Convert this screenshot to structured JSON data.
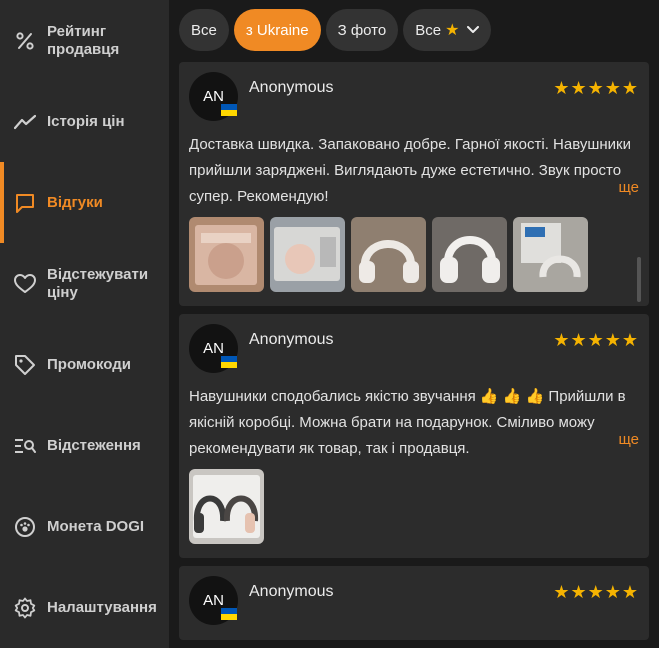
{
  "sidebar": {
    "items": [
      {
        "label": "Рейтинг продавця",
        "icon": "percent-icon"
      },
      {
        "label": "Історія цін",
        "icon": "trend-line-icon"
      },
      {
        "label": "Відгуки",
        "icon": "chat-bubble-icon",
        "active": true
      },
      {
        "label": "Відстежувати ціну",
        "icon": "heart-icon"
      },
      {
        "label": "Промокоди",
        "icon": "tag-icon"
      },
      {
        "label": "Відстеження",
        "icon": "list-search-icon"
      },
      {
        "label": "Монета DOGI",
        "icon": "coin-paw-icon"
      },
      {
        "label": "Налаштування",
        "icon": "gear-icon"
      }
    ]
  },
  "filters": {
    "all": "Все",
    "ukraine": "з Ukraine",
    "with_photo": "З фото",
    "rating": "Все"
  },
  "reviews": [
    {
      "avatar": "AN",
      "author": "Anonymous",
      "stars": "★★★★★",
      "text": "Доставка швидка. Запаковано добре. Гарної якості. Навушники прийшли заряджені. Виглядають дуже естетично. Звук просто супер. Рекомендую!",
      "more": "ще"
    },
    {
      "avatar": "AN",
      "author": "Anonymous",
      "stars": "★★★★★",
      "text": "Навушники сподобались якістю звучання 👍 👍 👍 Прийшли в якісній коробці. Можна брати на подарунок. Сміливо можу рекомендувати як товар, так і продавця.",
      "more": "ще"
    },
    {
      "avatar": "AN",
      "author": "Anonymous",
      "stars": "★★★★★"
    }
  ],
  "colors": {
    "accent": "#f08a24",
    "star": "#f5b301",
    "sidebar_bg": "#2a2a2a",
    "card_bg": "#2c2c2c"
  }
}
